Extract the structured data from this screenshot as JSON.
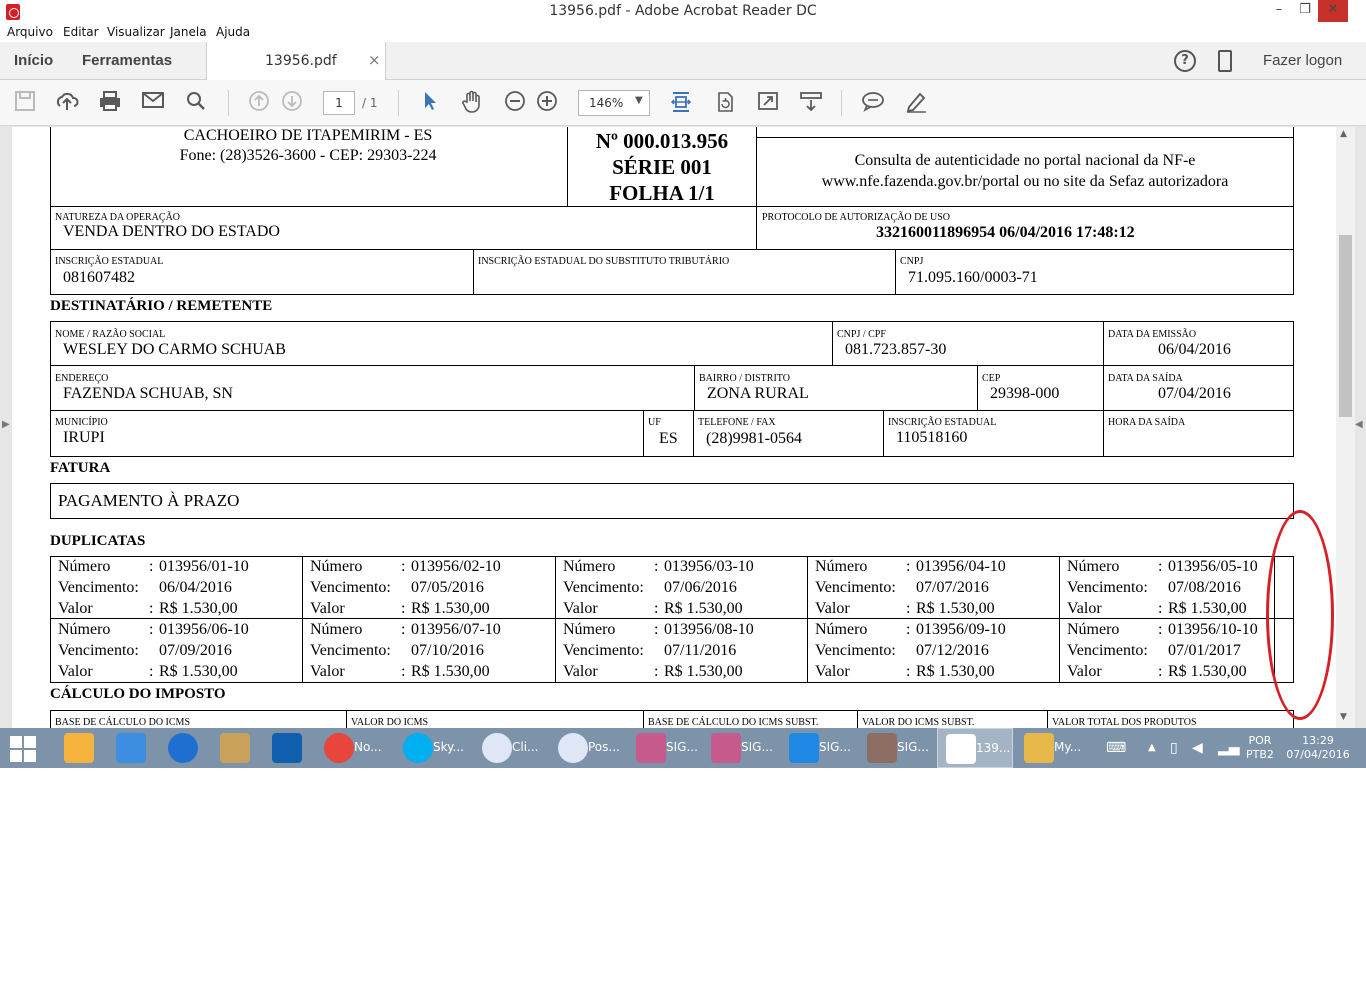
{
  "window": {
    "title": "13956.pdf - Adobe Acrobat Reader DC",
    "min": "–",
    "max": "❐",
    "close": "✕"
  },
  "menu": [
    "Arquivo",
    "Editar",
    "Visualizar",
    "Janela",
    "Ajuda"
  ],
  "tabs": {
    "home": "Início",
    "tools": "Ferramentas",
    "doc": "13956.pdf",
    "close": "×",
    "help": "?",
    "login": "Fazer logon"
  },
  "toolbar": {
    "page": "1",
    "page_total": "/ 1",
    "zoom": "146%",
    "zoom_dd": "▼"
  },
  "nfe": {
    "city": "CACHOEIRO DE ITAPEMIRIM - ES",
    "phone": "Fone: (28)3526-3600 - CEP: 29303-224",
    "number": "Nº 000.013.956",
    "series": "SÉRIE 001",
    "sheet": "FOLHA 1/1",
    "consult_1": "Consulta de autenticidade no portal nacional da NF-e",
    "consult_2": "www.nfe.fazenda.gov.br/portal ou no site da Sefaz autorizadora",
    "op_label": "NATUREZA DA OPERAÇÃO",
    "op_value": "VENDA DENTRO DO ESTADO",
    "proto_label": "PROTOCOLO DE AUTORIZAÇÃO DE USO",
    "proto_value": "332160011896954 06/04/2016 17:48:12",
    "ie_label": "INSCRIÇÃO ESTADUAL",
    "ie_value": "081607482",
    "iest_label": "INSCRIÇÃO ESTADUAL DO SUBSTITUTO TRIBUTÁRIO",
    "cnpj_label": "CNPJ",
    "cnpj_value": "71.095.160/0003-71",
    "dest_title": "DESTINATÁRIO / REMETENTE",
    "name_label": "NOME / RAZÃO SOCIAL",
    "name_value": "WESLEY DO CARMO SCHUAB",
    "cpf_label": "CNPJ / CPF",
    "cpf_value": "081.723.857-30",
    "emission_label": "DATA DA EMISSÃO",
    "emission_value": "06/04/2016",
    "addr_label": "ENDEREÇO",
    "addr_value": "FAZENDA SCHUAB, SN",
    "district_label": "BAIRRO / DISTRITO",
    "district_value": "ZONA RURAL",
    "cep_label": "CEP",
    "cep_value": "29398-000",
    "exit_label": "DATA DA SAÍDA",
    "exit_value": "07/04/2016",
    "city_label": "MUNICÍPIO",
    "city_value": "IRUPI",
    "uf_label": "UF",
    "uf_value": "ES",
    "tel_label": "TELEFONE / FAX",
    "tel_value": "(28)9981-0564",
    "ie2_label": "INSCRIÇÃO ESTADUAL",
    "ie2_value": "110518160",
    "hour_label": "HORA DA SAÍDA",
    "invoice_title": "FATURA",
    "invoice_value": "PAGAMENTO À PRAZO",
    "dup_title": "DUPLICATAS",
    "dup_num_label": "Número",
    "dup_due_label": "Vencimento:",
    "dup_val_label": "Valor",
    "dup_colon": ":",
    "duplicates": [
      {
        "num": "013956/01-10",
        "due": "06/04/2016",
        "val": "R$ 1.530,00"
      },
      {
        "num": "013956/02-10",
        "due": "07/05/2016",
        "val": "R$ 1.530,00"
      },
      {
        "num": "013956/03-10",
        "due": "07/06/2016",
        "val": "R$ 1.530,00"
      },
      {
        "num": "013956/04-10",
        "due": "07/07/2016",
        "val": "R$ 1.530,00"
      },
      {
        "num": "013956/05-10",
        "due": "07/08/2016",
        "val": "R$ 1.530,00"
      },
      {
        "num": "013956/06-10",
        "due": "07/09/2016",
        "val": "R$ 1.530,00"
      },
      {
        "num": "013956/07-10",
        "due": "07/10/2016",
        "val": "R$ 1.530,00"
      },
      {
        "num": "013956/08-10",
        "due": "07/11/2016",
        "val": "R$ 1.530,00"
      },
      {
        "num": "013956/09-10",
        "due": "07/12/2016",
        "val": "R$ 1.530,00"
      },
      {
        "num": "013956/10-10",
        "due": "07/01/2017",
        "val": "R$ 1.530,00"
      }
    ],
    "tax_title": "CÁLCULO DO IMPOSTO",
    "tax_cols": [
      "BASE DE CÁLCULO DO ICMS",
      "VALOR DO ICMS",
      "BASE DE CÁLCULO DO ICMS SUBST.",
      "VALOR DO ICMS SUBST.",
      "VALOR TOTAL DOS PRODUTOS"
    ]
  },
  "taskbar": {
    "apps": [
      {
        "label": "No...",
        "color": "#e8453c"
      },
      {
        "label": "Sky...",
        "color": "#00aff0"
      },
      {
        "label": "Cli...",
        "color": "#5a7bd1"
      },
      {
        "label": "Pos...",
        "color": "#5a7bd1"
      },
      {
        "label": "SIG...",
        "color": "#c0392b"
      },
      {
        "label": "SIG...",
        "color": "#c0392b"
      },
      {
        "label": "SIG...",
        "color": "#1e88e5"
      },
      {
        "label": "SIG...",
        "color": "#8d6e63"
      },
      {
        "label": "139...",
        "color": "#d32027"
      },
      {
        "label": "My...",
        "color": "#e6b84a"
      }
    ],
    "lang_1": "POR",
    "lang_2": "PTB2",
    "time": "13:29",
    "date": "07/04/2016"
  }
}
